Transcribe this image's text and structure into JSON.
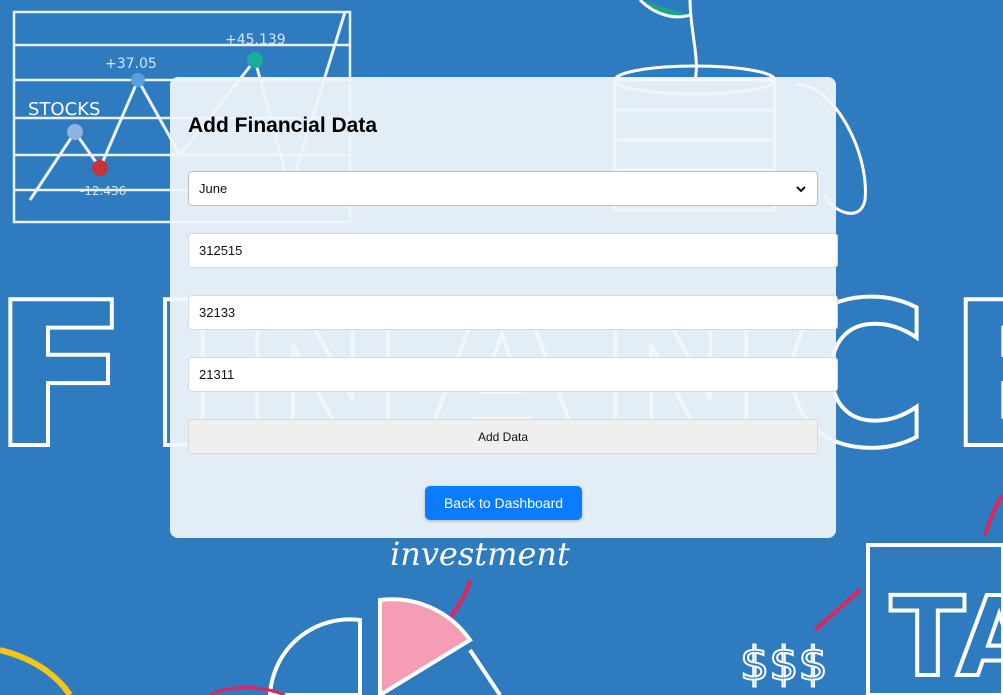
{
  "form": {
    "title": "Add Financial Data",
    "month_select": {
      "selected": "June"
    },
    "fields": [
      {
        "value": "312515"
      },
      {
        "value": "32133"
      },
      {
        "value": "21311"
      }
    ],
    "add_button_label": "Add Data",
    "back_button_label": "Back to Dashboard"
  },
  "background": {
    "theme_color": "#2e7bbf",
    "accent_color": "#0a7cff",
    "words": {
      "stocks": "STOCKS",
      "stock_up_1": "+37.05",
      "stock_up_2": "+45.139",
      "stock_down": "-12.436",
      "finance": "FINANCE",
      "investment": "investment",
      "dollars": "$$$",
      "tax_letter": "TA"
    }
  }
}
